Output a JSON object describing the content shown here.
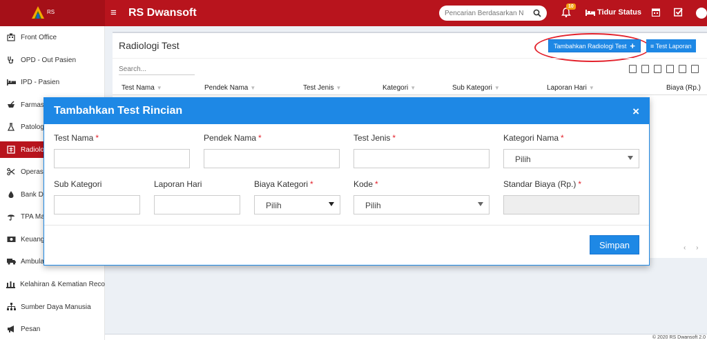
{
  "app": {
    "logo_text": "RS",
    "brand": "RS Dwansoft",
    "search_placeholder": "Pencarian Berdasarkan N",
    "notification_count": "10",
    "bed_status_label": "Tidur Status",
    "accent": "#b8141d",
    "primary": "#1e88e5"
  },
  "sidebar": {
    "items": [
      {
        "label": "Front Office",
        "icon": "building-icon"
      },
      {
        "label": "OPD - Out Pasien",
        "icon": "stethoscope-icon"
      },
      {
        "label": "IPD - Pasien",
        "icon": "bed-icon"
      },
      {
        "label": "Farmas",
        "icon": "mortar-icon"
      },
      {
        "label": "Patolog",
        "icon": "flask-icon"
      },
      {
        "label": "Radiolo",
        "icon": "xray-icon"
      },
      {
        "label": "Operas",
        "icon": "scissors-icon"
      },
      {
        "label": "Bank D",
        "icon": "blood-drop-icon"
      },
      {
        "label": "TPA Ma",
        "icon": "umbrella-icon"
      },
      {
        "label": "Keuang",
        "icon": "money-icon"
      },
      {
        "label": "Ambula",
        "icon": "ambulance-icon"
      },
      {
        "label": "Kelahiran & Kematian Reco",
        "icon": "family-icon"
      },
      {
        "label": "Sumber Daya Manusia",
        "icon": "sitemap-icon"
      },
      {
        "label": "Pesan",
        "icon": "bullhorn-icon"
      }
    ]
  },
  "panel": {
    "title": "Radiologi Test",
    "add_button": "Tambahkan Radiologi Test",
    "report_button": "≡ Test Laporan",
    "search_placeholder": "Search...",
    "columns": [
      "Test Nama",
      "Pendek Nama",
      "Test Jenis",
      "Kategori",
      "Sub Kategori",
      "Laporan Hari",
      "Biaya (Rp.)"
    ],
    "pager": "‹ ›"
  },
  "footer": {
    "text": "© 2020 RS Dwansoft 2.0"
  },
  "modal": {
    "title": "Tambahkan Test Rincian",
    "close": "×",
    "fields": {
      "test_nama": "Test Nama",
      "pendek_nama": "Pendek Nama",
      "test_jenis": "Test Jenis",
      "kategori_nama": "Kategori Nama",
      "sub_kategori": "Sub Kategori",
      "laporan_hari": "Laporan Hari",
      "biaya_kategori": "Biaya Kategori",
      "kode": "Kode",
      "standar_biaya": "Standar Biaya (Rp.)"
    },
    "required_mark": "*",
    "select_default": "Pilih",
    "save_button": "Simpan"
  }
}
